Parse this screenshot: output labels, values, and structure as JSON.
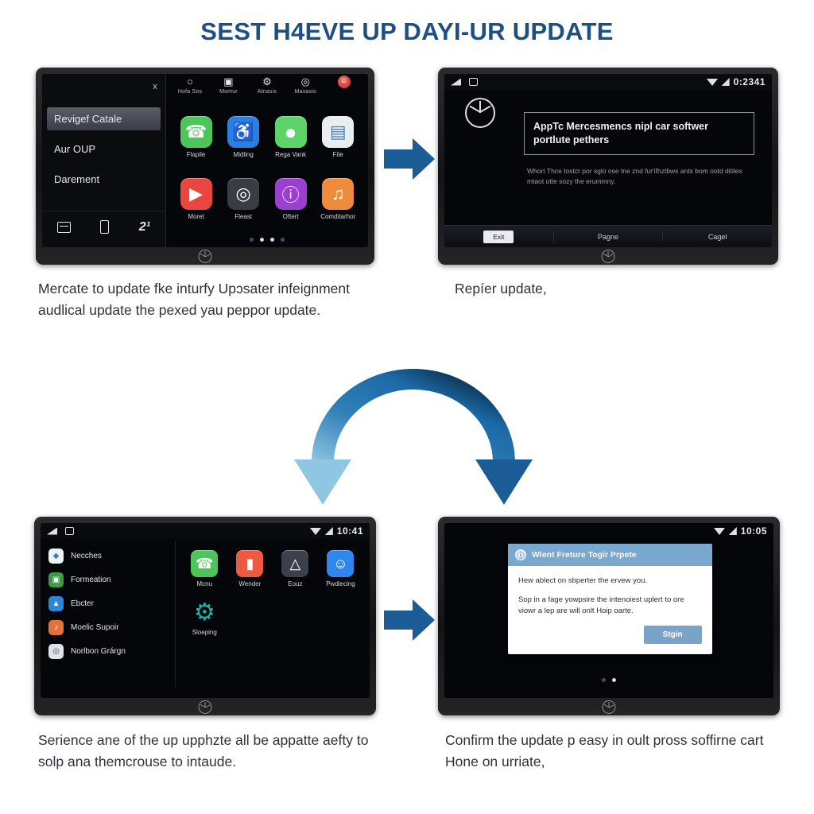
{
  "title": "SEST H4EVE UP DAYI-UR UPDATE",
  "colors": {
    "title_blue": "#1d4f84",
    "arrow_blue": "#1b5c96",
    "arch_light": "#7cb8d8",
    "dialog_blue": "#79a7cd"
  },
  "panel1": {
    "close_label": "x",
    "sidebar": {
      "items": [
        {
          "label": "Revigef Catale",
          "selected": true
        },
        {
          "label": "Aur OUP",
          "selected": false
        },
        {
          "label": "Darement",
          "selected": false
        }
      ],
      "dock": [
        {
          "icon": "card-icon",
          "label": ""
        },
        {
          "icon": "phone-device-icon",
          "label": ""
        },
        {
          "icon": "two-one-icon",
          "label": "2¹"
        }
      ]
    },
    "toprow": [
      {
        "icon": "shield-icon",
        "glyph": "○",
        "label": "Hofa Sos"
      },
      {
        "icon": "card-small-icon",
        "glyph": "▣",
        "label": "Momur"
      },
      {
        "icon": "gear-icon",
        "glyph": "⚙",
        "label": "Atnasis"
      },
      {
        "icon": "clock-icon",
        "glyph": "◎",
        "label": "Maxasio"
      },
      {
        "icon": "alert-badge-icon",
        "glyph": "☹",
        "label": ""
      }
    ],
    "apps": [
      {
        "label": "Flapile",
        "glyph": "☎",
        "color": "#4cc55a",
        "icon": "phone-app-icon"
      },
      {
        "label": "Midling",
        "glyph": "♿",
        "color": "#2a7fe0",
        "icon": "accessibility-app-icon"
      },
      {
        "label": "Rega Vank",
        "glyph": "●",
        "color": "#5dd36a",
        "icon": "messages-app-icon"
      },
      {
        "label": "Fite",
        "glyph": "▤",
        "color": "#e8eef2",
        "icon": "files-app-icon"
      },
      {
        "label": "Moret",
        "glyph": "▶",
        "color": "#e8463f",
        "icon": "media-app-icon"
      },
      {
        "label": "Fleast",
        "glyph": "◎",
        "color": "#3a3c45",
        "icon": "camera-app-icon"
      },
      {
        "label": "Oftert",
        "glyph": "ⓘ",
        "color": "#9a3fd0",
        "icon": "info-app-icon"
      },
      {
        "label": "Comditarhor",
        "glyph": "♫",
        "color": "#f08b3c",
        "icon": "music-app-icon"
      }
    ],
    "page_dots": [
      false,
      true,
      true,
      false
    ]
  },
  "panel2": {
    "status": {
      "time": "0:2341",
      "icons": [
        "volume-icon",
        "screen-icon",
        "wifi-icon",
        "signal-icon"
      ]
    },
    "logo": "mercedes-star-logo",
    "headline": "AppTc Mercesmencs nipl car softwer portlute pethers",
    "body": "Whort Thce tostcr por sglo ose tne znd fur'ifhztbws antx bom ootd ditiles mtaot otte sozy the erummny.",
    "buttons": [
      {
        "label": "Exit",
        "highlighted": true
      },
      {
        "label": "Pagne",
        "highlighted": false
      },
      {
        "label": "Cagel",
        "highlighted": false
      }
    ]
  },
  "panel3": {
    "status": {
      "time": "10:41",
      "icons": [
        "volume-icon",
        "screen-icon",
        "wifi-icon",
        "signal-icon"
      ]
    },
    "list": [
      {
        "label": "Necches",
        "glyph": "◆",
        "color": "#eef2f6",
        "icon": "globe-list-icon"
      },
      {
        "label": "Formeation",
        "glyph": "▣",
        "color": "#3f9a46",
        "icon": "document-list-icon"
      },
      {
        "label": "Ebcter",
        "glyph": "▲",
        "color": "#2f86d8",
        "icon": "home-list-icon"
      },
      {
        "label": "Moelic Supoir",
        "glyph": "♪",
        "color": "#e2723a",
        "icon": "music-list-icon"
      },
      {
        "label": "Norlbon Grárgn",
        "glyph": "◎",
        "color": "#dfe4ea",
        "icon": "compass-list-icon"
      }
    ],
    "apps": [
      {
        "label": "Mcnu",
        "glyph": "☎",
        "color": "#4cc55a",
        "icon": "phone-app-icon"
      },
      {
        "label": "Wender",
        "glyph": "▮",
        "color": "#ec5a3f",
        "icon": "map-app-icon"
      },
      {
        "label": "Eouz",
        "glyph": "△",
        "color": "#3b404c",
        "icon": "navigation-app-icon"
      },
      {
        "label": "Pwdiecing",
        "glyph": "☺",
        "color": "#2f86ef",
        "icon": "assistant-app-icon"
      },
      {
        "label": "Sloeping",
        "glyph": "⚙",
        "color": "#16b5a8",
        "icon": "settings-app-icon"
      }
    ]
  },
  "panel4": {
    "status": {
      "time": "10:05",
      "icons": [
        "wifi-icon",
        "signal-icon"
      ]
    },
    "dialog": {
      "title": "Wlent Freture Togir Prpete",
      "title_icon": "info-circle-icon",
      "body_lines": [
        "Hew ablect on sbperter the ervew you.",
        "Sop in a fage yowpsire the intenoiest uplert to ore viowr a lep are will onlt Hoip oarte."
      ],
      "button": "Stgin"
    },
    "page_dots": [
      false,
      true
    ]
  },
  "arrows": {
    "top": "arrow-right-icon",
    "bottom": "arrow-right-icon",
    "middle": "curved-double-arrow-icon"
  },
  "captions": {
    "p1": "Mercate to update fke inturfy Upɔsater infeignment audlical update the pexed yau peppor update.",
    "p2": "Repíer update,",
    "p3": "Serience ane of the up upphzte all be appatte aefty to solp ana themcrouse to intaude.",
    "p4": "Confirm the update p easy in oult pross soffirne cart Hone on urriate,"
  }
}
